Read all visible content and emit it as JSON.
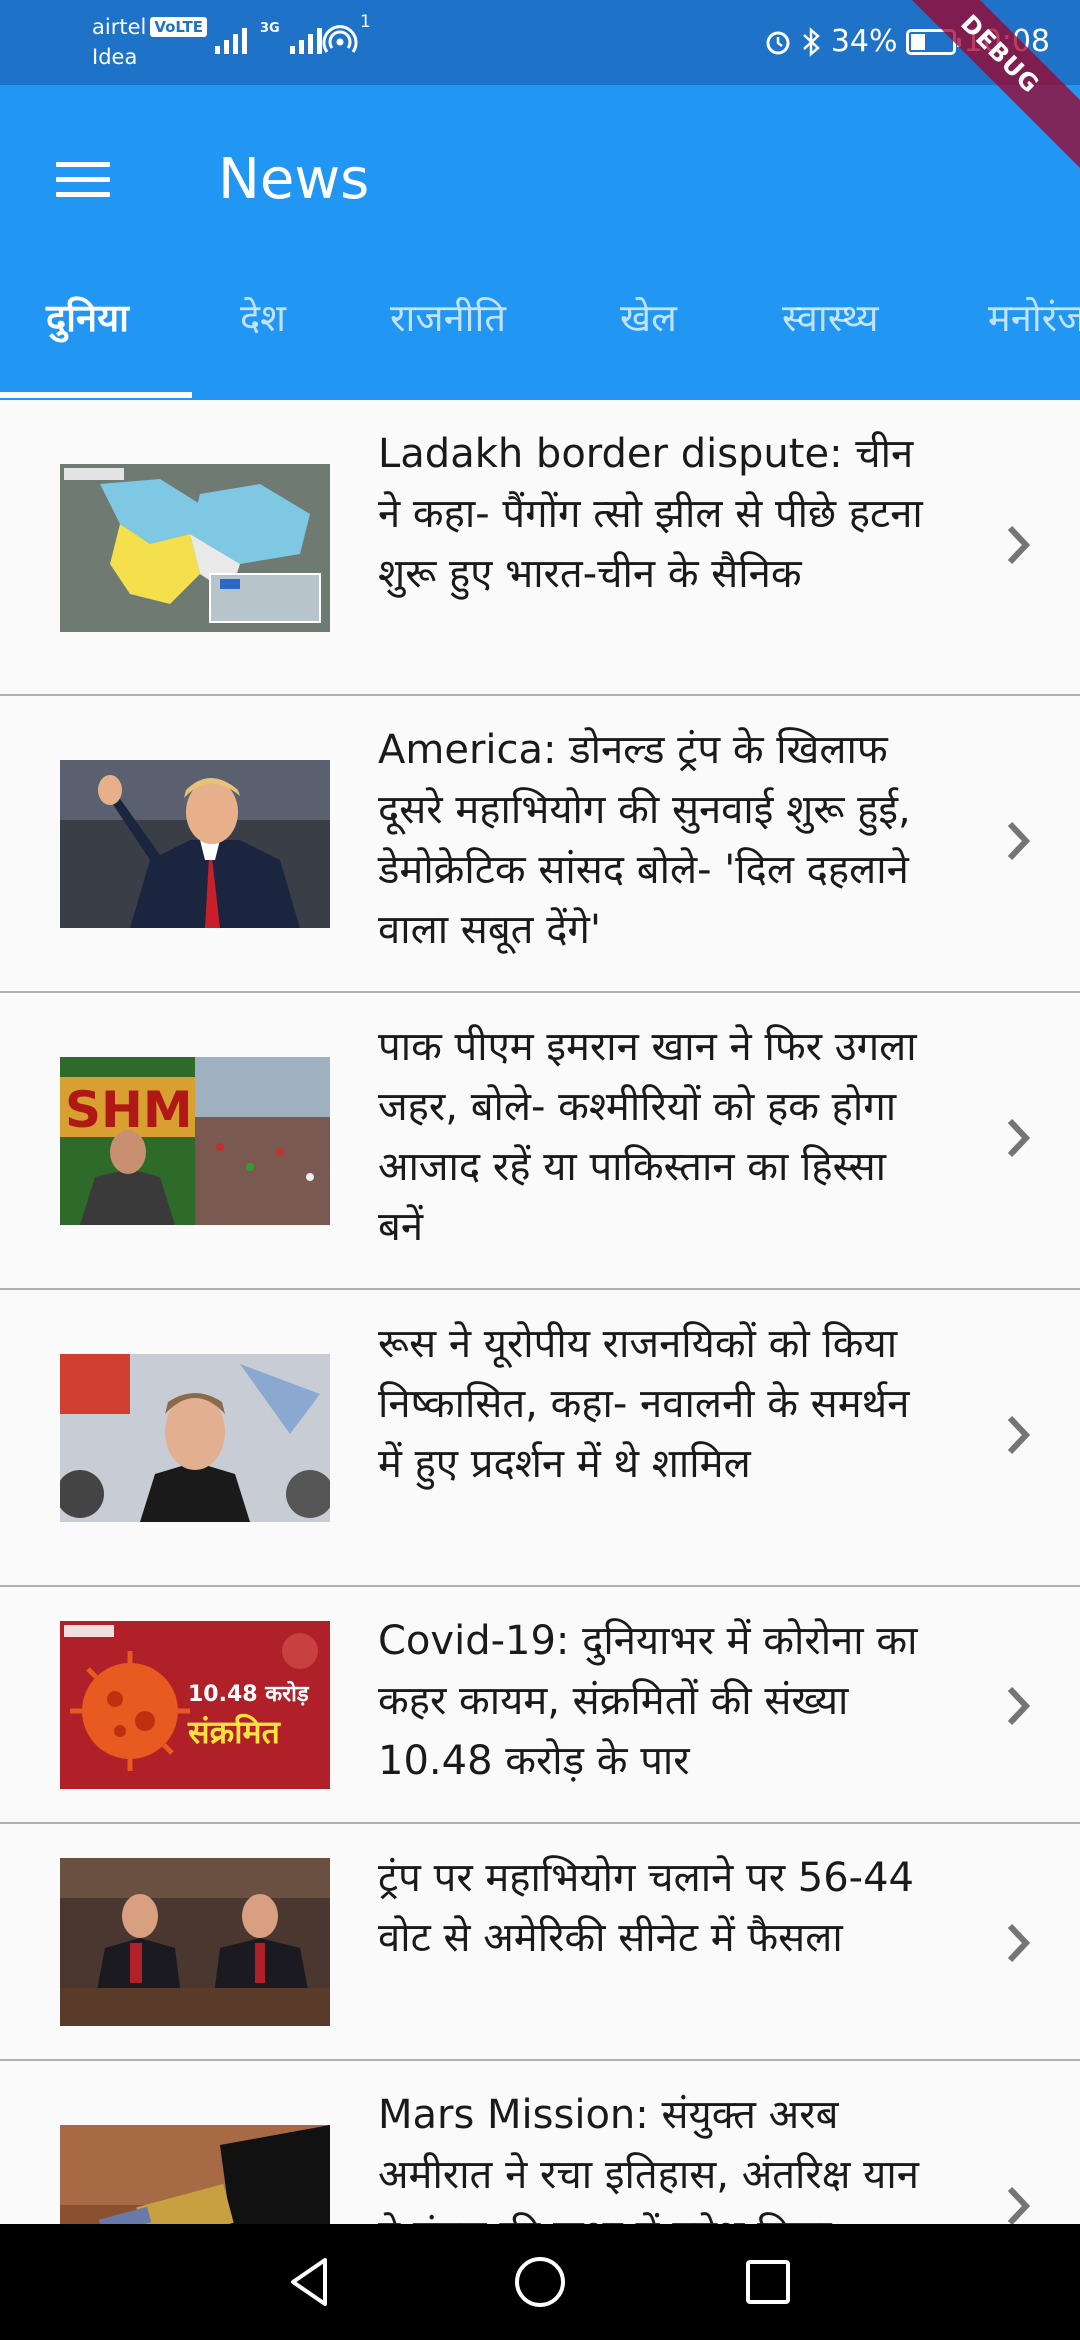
{
  "status_bar": {
    "carrier_1": "airtel",
    "volte": "VoLTE",
    "carrier_2": "Idea",
    "network_type": "3G",
    "hotspot_count": "1",
    "battery_percent": "34%",
    "battery_level": 0.34,
    "time": "10:08"
  },
  "app_bar": {
    "title": "News",
    "menu_icon": "hamburger-menu-icon"
  },
  "tabs": [
    {
      "label": "दुनिया",
      "active": true
    },
    {
      "label": "देश",
      "active": false
    },
    {
      "label": "राजनीति",
      "active": false
    },
    {
      "label": "खेल",
      "active": false
    },
    {
      "label": "स्वास्थ्य",
      "active": false
    },
    {
      "label": "मनोरंजन",
      "active": false
    }
  ],
  "news": [
    {
      "headline": "Ladakh border dispute: चीन ने कहा- पैंगोंग त्सो झील से पीछे हटना शुरू हुए भारत-चीन के सैनिक",
      "thumbnail": "ladakh-map-thumbnail"
    },
    {
      "headline": "America: डोनल्ड ट्रंप के खिलाफ दूसरे महाभियोग की सुनवाई शुरू हुई, डेमोक्रेटिक सांसद बोले- 'दिल दहलाने वाला सबूत देंगे'",
      "thumbnail": "trump-waving-thumbnail"
    },
    {
      "headline": "पाक पीएम इमरान खान ने फिर उगला जहर, बोले- कश्मीरियों को हक होगा आजाद रहें या पाकिस्तान का हिस्सा बनें",
      "thumbnail": "imran-khan-rally-thumbnail"
    },
    {
      "headline": "रूस ने यूरोपीय राजनयिकों को किया निष्कासित, कहा- नवालनी के समर्थन में हुए प्रदर्शन में थे शामिल",
      "thumbnail": "navalny-thumbnail"
    },
    {
      "headline": "Covid-19: दुनियाभर में कोरोना का कहर कायम, संक्रमितों की संख्या 10.48 करोड़ के पार",
      "thumbnail": "covid-virus-thumbnail",
      "thumb_text_1": "10.48 करोड़",
      "thumb_text_2": "संक्रमित"
    },
    {
      "headline": "ट्रंप पर महाभियोग चलाने पर 56-44 वोट से अमेरिकी सीनेट में फैसला",
      "thumbnail": "senate-thumbnail"
    },
    {
      "headline": "Mars Mission: संयुक्त अरब अमीरात ने रचा इतिहास, अंतरिक्ष यान ने मंगल की कक्षा में प्रवेश किया",
      "thumbnail": "mars-mission-thumbnail"
    }
  ],
  "debug_banner": "DEBUG",
  "colors": {
    "status_bar": "#1e72c8",
    "app_bar": "#2196f3",
    "background": "#fafafa",
    "divider": "#b0b0b0"
  }
}
